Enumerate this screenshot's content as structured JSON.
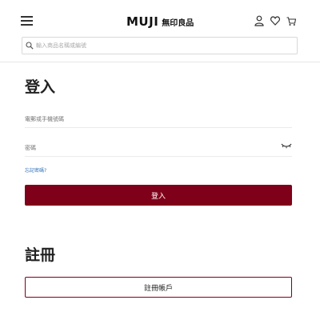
{
  "header": {
    "logo_text": "MUJI",
    "logo_cjk": "無印良品",
    "icons": [
      "menu-icon",
      "user-icon",
      "heart-icon",
      "cart-icon"
    ]
  },
  "search": {
    "placeholder": "輸入商品名稱或編號",
    "icon": "search-icon"
  },
  "login": {
    "title": "登入",
    "phone_placeholder": "電郵或手機號碼",
    "password_placeholder": "密碼",
    "eye_icon": "eye-closed-icon",
    "forgot_label": "忘記密碼?",
    "submit_label": "登入"
  },
  "register": {
    "title": "註冊",
    "button_label": "註冊帳戶"
  },
  "colors": {
    "accent": "#7f0019",
    "link": "#2f6fb8"
  }
}
